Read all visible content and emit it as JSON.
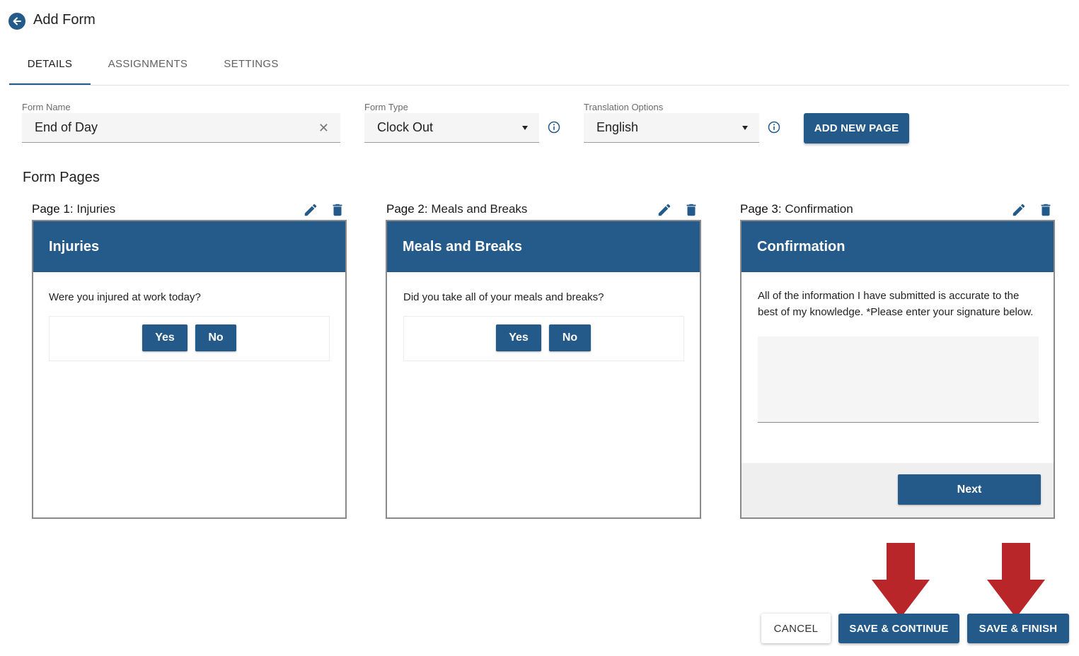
{
  "header": {
    "title": "Add Form",
    "back_icon": "arrow-left-circle-icon"
  },
  "tabs": [
    {
      "label": "DETAILS",
      "active": true
    },
    {
      "label": "ASSIGNMENTS",
      "active": false
    },
    {
      "label": "SETTINGS",
      "active": false
    }
  ],
  "form": {
    "name_label": "Form Name",
    "name_value": "End of Day",
    "type_label": "Form Type",
    "type_value": "Clock Out",
    "translation_label": "Translation Options",
    "translation_value": "English",
    "add_page_label": "ADD NEW PAGE"
  },
  "form_pages": {
    "title": "Form Pages",
    "pages": [
      {
        "prefix": "Page 1:",
        "name": "Injuries",
        "header": "Injuries",
        "question": "Were you injured at work today?",
        "yes_label": "Yes",
        "no_label": "No"
      },
      {
        "prefix": "Page 2:",
        "name": "Meals and Breaks",
        "header": "Meals and Breaks",
        "question": "Did you take all of your meals and breaks?",
        "yes_label": "Yes",
        "no_label": "No"
      },
      {
        "prefix": "Page 3:",
        "name": "Confirmation",
        "header": "Confirmation",
        "question": "All of the information I have submitted is accurate to the best of my knowledge. *Please enter your signature below.",
        "next_label": "Next"
      }
    ]
  },
  "actions": {
    "cancel_label": "CANCEL",
    "save_continue_label": "SAVE & CONTINUE",
    "save_finish_label": "SAVE & FINISH"
  },
  "colors": {
    "primary": "#235a89",
    "card_header": "#255b8a",
    "annotation_arrow": "#b8262a"
  }
}
